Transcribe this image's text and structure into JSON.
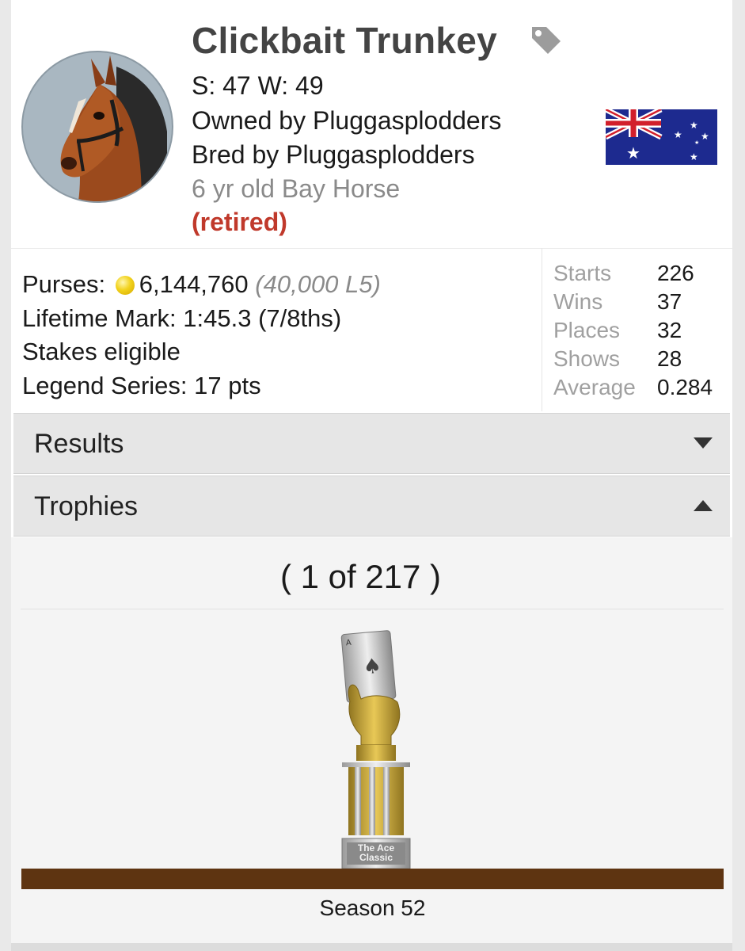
{
  "horse": {
    "name": "Clickbait Trunkey",
    "sw": "S: 47 W: 49",
    "owner": "Owned by Pluggasplodders",
    "breeder": "Bred by Pluggasplodders",
    "description": "6 yr old Bay Horse",
    "status": "(retired)"
  },
  "stats": {
    "purses_label": "Purses:",
    "purses_value": "6,144,760",
    "purses_l5": "(40,000 L5)",
    "lifetime_mark": "Lifetime Mark: 1:45.3 (7/8ths)",
    "stakes": "Stakes eligible",
    "legend": "Legend Series: 17 pts",
    "table": [
      {
        "label": "Starts",
        "value": "226"
      },
      {
        "label": "Wins",
        "value": "37"
      },
      {
        "label": "Places",
        "value": "32"
      },
      {
        "label": "Shows",
        "value": "28"
      },
      {
        "label": "Average",
        "value": "0.284"
      }
    ]
  },
  "sections": {
    "results": "Results",
    "trophies": "Trophies"
  },
  "trophy": {
    "counter": "( 1 of 217 )",
    "plaque_line1": "The Ace",
    "plaque_line2": "Classic",
    "season": "Season 52"
  },
  "colors": {
    "retired": "#c0392b",
    "shelf": "#5e3411",
    "coin": "#f2d21c"
  },
  "icons": {
    "tag": "tag-icon",
    "flag": "australia-flag",
    "chevron_down": "chevron-down-icon",
    "chevron_up": "chevron-up-icon"
  }
}
